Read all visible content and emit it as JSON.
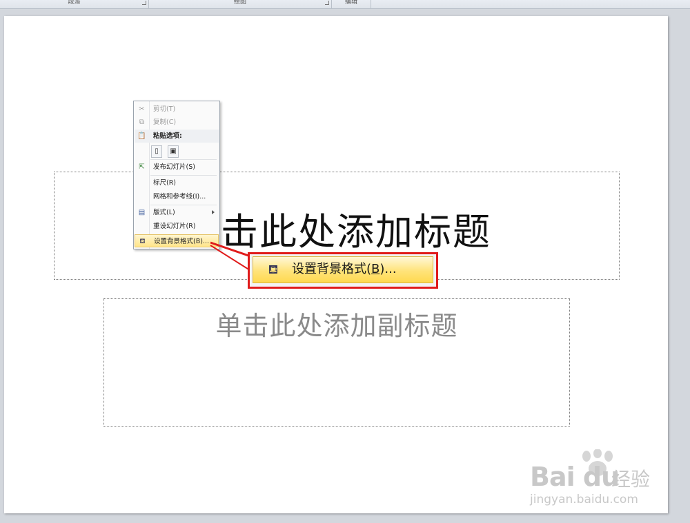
{
  "ribbon": {
    "groups": [
      {
        "label": "段落"
      },
      {
        "label": "绘图"
      },
      {
        "label": "编辑"
      }
    ]
  },
  "slide": {
    "title": "单击此处添加标题",
    "subtitle": "单击此处添加副标题"
  },
  "context_menu": {
    "items": [
      {
        "label": "剪切(T)",
        "icon": "scissors-icon",
        "enabled": false
      },
      {
        "label": "复制(C)",
        "icon": "copy-icon",
        "enabled": false
      },
      {
        "label": "粘贴选项:",
        "icon": "paste-icon",
        "enabled": true,
        "header": true
      },
      {
        "label": "发布幻灯片(S)",
        "icon": "publish-icon",
        "enabled": true
      },
      {
        "label": "标尺(R)",
        "icon": "",
        "enabled": true
      },
      {
        "label": "网格和参考线(I)...",
        "icon": "",
        "enabled": true
      },
      {
        "label": "版式(L)",
        "icon": "layout-icon",
        "enabled": true,
        "submenu": true
      },
      {
        "label": "重设幻灯片(R)",
        "icon": "",
        "enabled": true
      },
      {
        "label": "设置背景格式(B)...",
        "icon": "paint-bucket-icon",
        "enabled": true,
        "highlighted": true
      }
    ],
    "paste_options": [
      {
        "icon": "paste-keep-icon"
      },
      {
        "icon": "paste-picture-icon"
      }
    ]
  },
  "callout": {
    "label_prefix": "设置背景格式(",
    "label_key": "B",
    "label_suffix": ")...",
    "border_color": "#e01b1b"
  },
  "watermark": {
    "brand": "Bai du",
    "name": "经验",
    "url": "jingyan.baidu.com"
  }
}
